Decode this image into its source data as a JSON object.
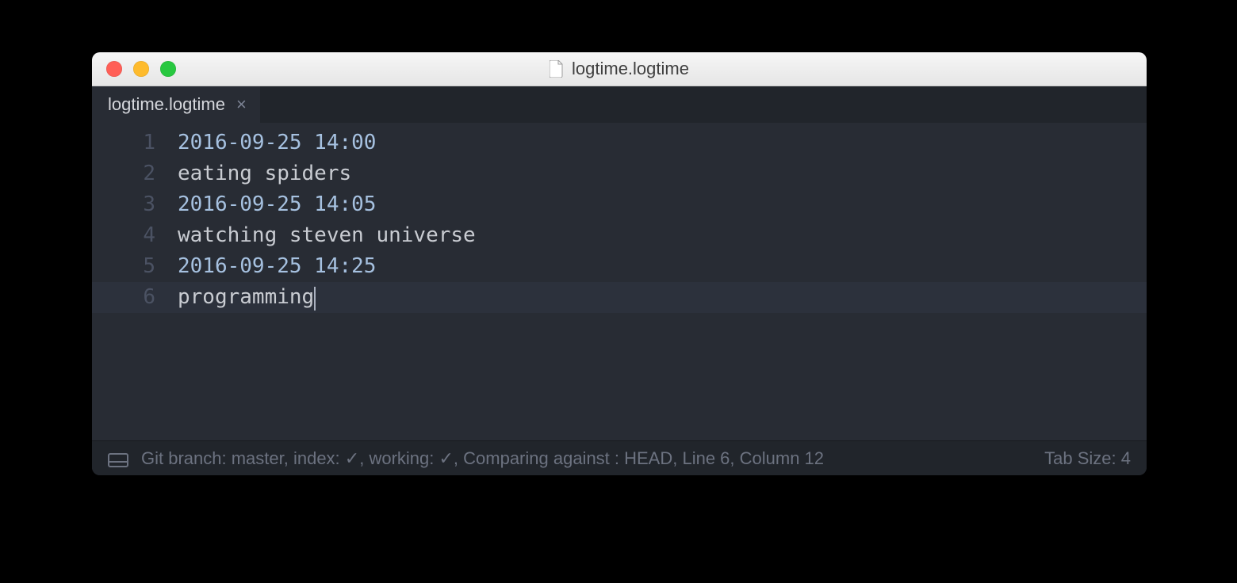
{
  "window": {
    "title": "logtime.logtime"
  },
  "tab": {
    "label": "logtime.logtime"
  },
  "editor": {
    "lines": [
      {
        "n": "1",
        "text": "2016-09-25 14:00",
        "kind": "timestamp",
        "current": false
      },
      {
        "n": "2",
        "text": "eating spiders",
        "kind": "plain",
        "current": false
      },
      {
        "n": "3",
        "text": "2016-09-25 14:05",
        "kind": "timestamp",
        "current": false
      },
      {
        "n": "4",
        "text": "watching steven universe",
        "kind": "plain",
        "current": false
      },
      {
        "n": "5",
        "text": "2016-09-25 14:25",
        "kind": "timestamp",
        "current": false
      },
      {
        "n": "6",
        "text": "programming",
        "kind": "plain",
        "current": true
      }
    ]
  },
  "status": {
    "left": "Git branch: master, index: ✓, working: ✓, Comparing against : HEAD, Line 6, Column 12",
    "right": "Tab Size: 4"
  }
}
